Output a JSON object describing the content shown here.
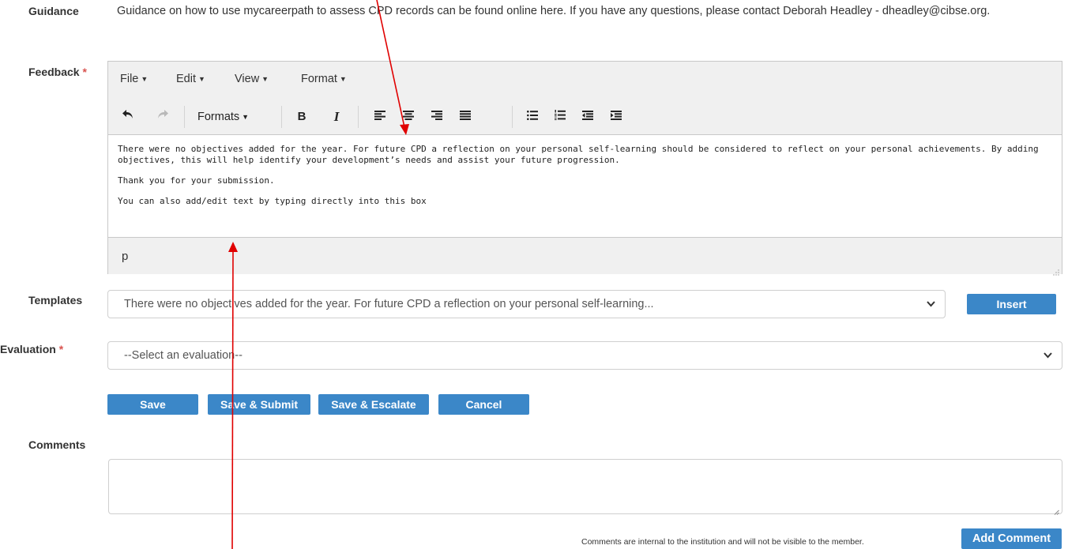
{
  "guidance": {
    "label": "Guidance",
    "text": "Guidance on how to use mycareerpath to assess CPD records can be found online here. If you have any questions, please contact Deborah Headley - dheadley@cibse.org."
  },
  "feedback": {
    "label": "Feedback",
    "required_mark": "*",
    "menubar": [
      "File",
      "Edit",
      "View",
      "Format"
    ],
    "formats_label": "Formats",
    "bold_label": "B",
    "italic_label": "I",
    "paragraphs": [
      "There were no objectives added for the year. For future CPD a reflection on your personal self-learning should be considered to reflect on your personal achievements. By adding objectives, this will help identify your development’s needs and assist your future progression.",
      "Thank you for your submission.",
      "You can also add/edit text by typing directly into this box"
    ],
    "status_path": "p"
  },
  "templates": {
    "label": "Templates",
    "selected": "There were no objectives added for the year. For future CPD a reflection on your personal self-learning...",
    "insert_label": "Insert"
  },
  "evaluation": {
    "label": "Evaluation",
    "required_mark": "*",
    "selected": "--Select an evaluation--"
  },
  "actions": {
    "save": "Save",
    "save_submit": "Save & Submit",
    "save_escalate": "Save & Escalate",
    "cancel": "Cancel"
  },
  "comments": {
    "label": "Comments",
    "value": "",
    "note": "Comments are internal to the institution and will not be visible to the member.",
    "add_label": "Add Comment"
  },
  "colors": {
    "button": "#3b87c8",
    "required": "#d9534f",
    "arrow": "#e00000"
  }
}
